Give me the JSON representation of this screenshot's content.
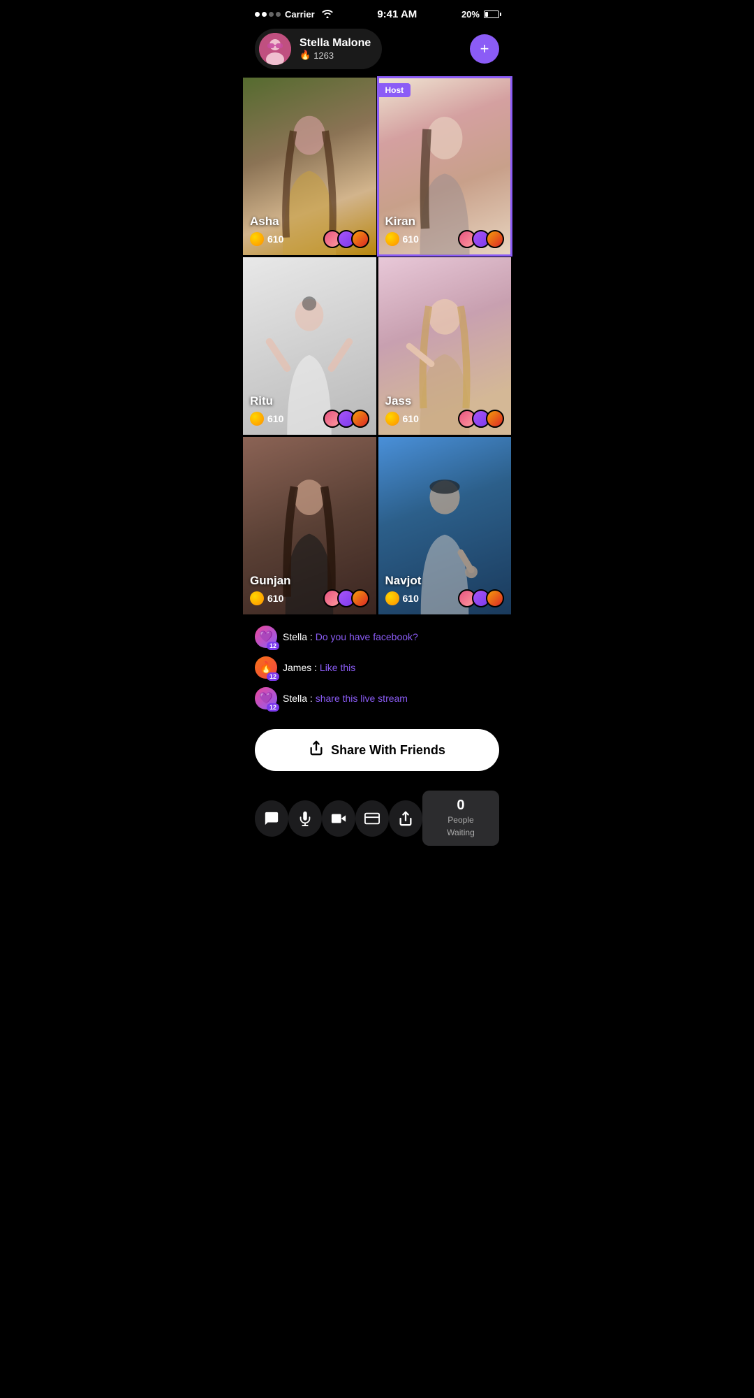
{
  "statusBar": {
    "carrier": "Carrier",
    "time": "9:41 AM",
    "battery": "20%"
  },
  "userHeader": {
    "name": "Stella Malone",
    "score": "1263",
    "addButtonLabel": "+"
  },
  "streamGrid": [
    {
      "id": "asha",
      "name": "Asha",
      "coins": "610",
      "isHost": false,
      "bgClass": "bg-asha"
    },
    {
      "id": "kiran",
      "name": "Kiran",
      "coins": "610",
      "isHost": true,
      "hostLabel": "Host",
      "bgClass": "bg-kiran"
    },
    {
      "id": "ritu",
      "name": "Ritu",
      "coins": "610",
      "isHost": false,
      "bgClass": "bg-ritu"
    },
    {
      "id": "jass",
      "name": "Jass",
      "coins": "610",
      "isHost": false,
      "bgClass": "bg-jass"
    },
    {
      "id": "gunjan",
      "name": "Gunjan",
      "coins": "610",
      "isHost": false,
      "bgClass": "bg-gunjan"
    },
    {
      "id": "navjot",
      "name": "Navjot",
      "coins": "610",
      "isHost": false,
      "bgClass": "bg-navjot"
    }
  ],
  "chat": {
    "messages": [
      {
        "id": "msg1",
        "sender": "Stella",
        "message": "Do you have facebook?",
        "avatarClass": "chat-av-stella",
        "badge": "12",
        "avatarEmoji": "💜"
      },
      {
        "id": "msg2",
        "sender": "James",
        "message": "Like this",
        "avatarClass": "chat-av-james",
        "badge": "12",
        "avatarEmoji": "🔥"
      },
      {
        "id": "msg3",
        "sender": "Stella",
        "message": "share this live stream",
        "avatarClass": "chat-av-stella",
        "badge": "12",
        "avatarEmoji": "💜"
      }
    ]
  },
  "shareButton": {
    "label": "Share With Friends"
  },
  "bottomBar": {
    "icons": [
      "chat",
      "mic",
      "video",
      "wallet",
      "share"
    ],
    "peopleWaiting": {
      "count": "0",
      "label": "People Waiting"
    }
  }
}
